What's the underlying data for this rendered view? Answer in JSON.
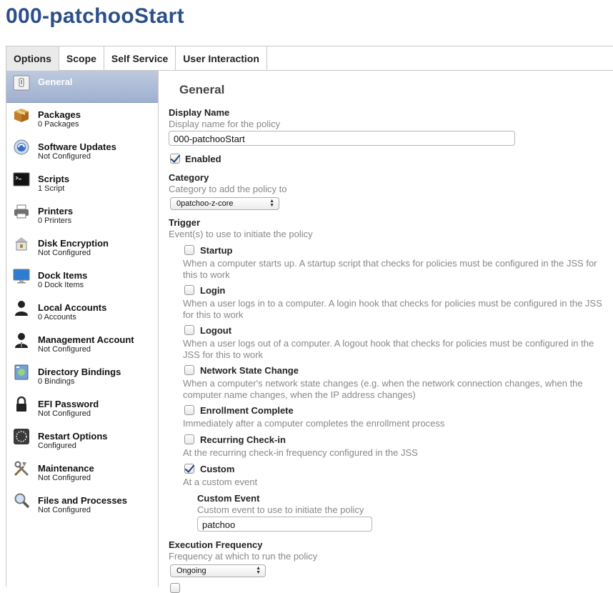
{
  "page": {
    "title": "000-patchooStart"
  },
  "tabs": [
    {
      "label": "Options"
    },
    {
      "label": "Scope"
    },
    {
      "label": "Self Service"
    },
    {
      "label": "User Interaction"
    }
  ],
  "sidebar": {
    "items": [
      {
        "label": "General",
        "sub": "",
        "icon": "general-icon"
      },
      {
        "label": "Packages",
        "sub": "0 Packages",
        "icon": "package-icon"
      },
      {
        "label": "Software Updates",
        "sub": "Not Configured",
        "icon": "software-update-icon"
      },
      {
        "label": "Scripts",
        "sub": "1 Script",
        "icon": "terminal-icon"
      },
      {
        "label": "Printers",
        "sub": "0 Printers",
        "icon": "printer-icon"
      },
      {
        "label": "Disk Encryption",
        "sub": "Not Configured",
        "icon": "disk-encryption-icon"
      },
      {
        "label": "Dock Items",
        "sub": "0 Dock Items",
        "icon": "monitor-icon"
      },
      {
        "label": "Local Accounts",
        "sub": "0 Accounts",
        "icon": "user-icon"
      },
      {
        "label": "Management Account",
        "sub": "Not Configured",
        "icon": "admin-user-icon"
      },
      {
        "label": "Directory Bindings",
        "sub": "0 Bindings",
        "icon": "directory-icon"
      },
      {
        "label": "EFI Password",
        "sub": "Not Configured",
        "icon": "lock-icon"
      },
      {
        "label": "Restart Options",
        "sub": "Configured",
        "icon": "restart-icon"
      },
      {
        "label": "Maintenance",
        "sub": "Not Configured",
        "icon": "tools-icon"
      },
      {
        "label": "Files and Processes",
        "sub": "Not Configured",
        "icon": "magnifier-icon"
      }
    ]
  },
  "general": {
    "section_title": "General",
    "display_name": {
      "label": "Display Name",
      "desc": "Display name for the policy",
      "value": "000-patchooStart"
    },
    "enabled": {
      "label": "Enabled",
      "checked": true
    },
    "category": {
      "label": "Category",
      "desc": "Category to add the policy to",
      "value": "0patchoo-z-core"
    },
    "trigger": {
      "label": "Trigger",
      "desc": "Event(s) to use to initiate the policy",
      "items": [
        {
          "label": "Startup",
          "checked": false,
          "desc": "When a computer starts up. A startup script that checks for policies must be configured in the JSS for this to work"
        },
        {
          "label": "Login",
          "checked": false,
          "desc": "When a user logs in to a computer. A login hook that checks for policies must be configured in the JSS for this to work"
        },
        {
          "label": "Logout",
          "checked": false,
          "desc": "When a user logs out of a computer. A logout hook that checks for policies must be configured in the JSS for this to work"
        },
        {
          "label": "Network State Change",
          "checked": false,
          "desc": "When a computer's network state changes (e.g. when the network connection changes, when the computer name changes, when the IP address changes)"
        },
        {
          "label": "Enrollment Complete",
          "checked": false,
          "desc": "Immediately after a computer completes the enrollment process"
        },
        {
          "label": "Recurring Check-in",
          "checked": false,
          "desc": "At the recurring check-in frequency configured in the JSS"
        },
        {
          "label": "Custom",
          "checked": true,
          "desc": "At a custom event"
        }
      ]
    },
    "custom_event": {
      "label": "Custom Event",
      "desc": "Custom event to use to initiate the policy",
      "value": "patchoo"
    },
    "execution_frequency": {
      "label": "Execution Frequency",
      "desc": "Frequency at which to run the policy",
      "value": "Ongoing"
    }
  },
  "colors": {
    "title": "#2a4f8a",
    "sidebar_active": "#a9b8d4",
    "checkmark": "#1f3f7a"
  }
}
